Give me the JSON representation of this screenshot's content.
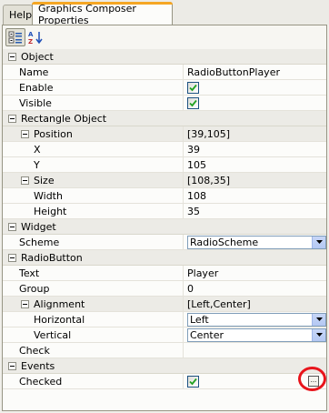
{
  "tabs": [
    {
      "label": "Help"
    },
    {
      "label": "Graphics Composer Properties"
    }
  ],
  "toolbar": {
    "categorized_icon": "categorized-icon",
    "alphabetical_icon": "alphabetical-icon"
  },
  "properties": {
    "object": {
      "category": "Object",
      "name_label": "Name",
      "name_value": "RadioButtonPlayer",
      "enable_label": "Enable",
      "visible_label": "Visible"
    },
    "rect": {
      "category": "Rectangle Object",
      "position_label": "Position",
      "position_value": "[39,105]",
      "x_label": "X",
      "x_value": "39",
      "y_label": "Y",
      "y_value": "105",
      "size_label": "Size",
      "size_value": "[108,35]",
      "width_label": "Width",
      "width_value": "108",
      "height_label": "Height",
      "height_value": "35"
    },
    "widget": {
      "category": "Widget",
      "scheme_label": "Scheme",
      "scheme_value": "RadioScheme"
    },
    "radio": {
      "category": "RadioButton",
      "text_label": "Text",
      "text_value": "Player",
      "group_label": "Group",
      "group_value": "0",
      "alignment_label": "Alignment",
      "alignment_value": "[Left,Center]",
      "horizontal_label": "Horizontal",
      "horizontal_value": "Left",
      "vertical_label": "Vertical",
      "vertical_value": "Center",
      "check_label": "Check"
    },
    "events": {
      "category": "Events",
      "checked_label": "Checked",
      "ellipsis_label": "..."
    }
  },
  "colors": {
    "highlight": "#e8141b",
    "active_tab_accent": "#f5a623"
  }
}
